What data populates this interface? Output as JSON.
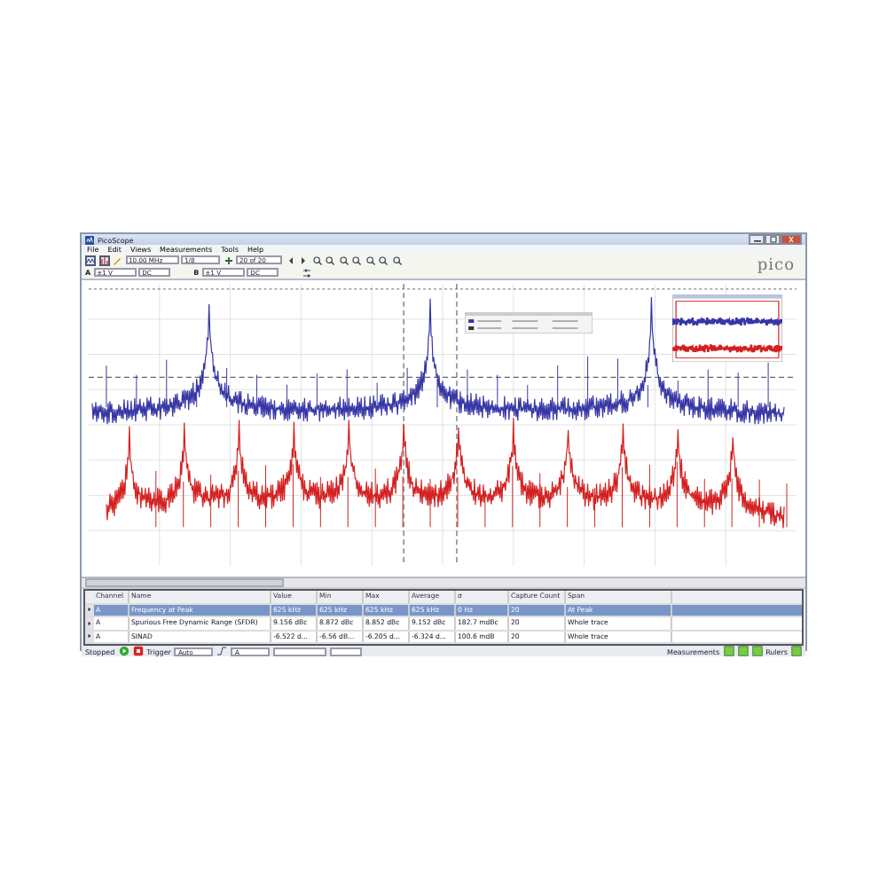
{
  "window": {
    "title": "PicoScope"
  },
  "menu": [
    "File",
    "Edit",
    "Views",
    "Measurements",
    "Tools",
    "Help"
  ],
  "toolbar": {
    "timebase": "10.00 MHz",
    "zoom": "1/8",
    "buffer": "20 of 20"
  },
  "channels": [
    {
      "name": "A",
      "range": "±1 V",
      "coupling": "DC"
    },
    {
      "name": "B",
      "range": "±1 V",
      "coupling": "DC"
    }
  ],
  "logo": "pico",
  "measurements": {
    "columns": [
      "Channel",
      "Name",
      "Value",
      "Min",
      "Max",
      "Average",
      "σ",
      "Capture Count",
      "Span"
    ],
    "rows": [
      {
        "selected": true,
        "cells": [
          "A",
          "Frequency at Peak",
          "625 kHz",
          "625 kHz",
          "625 kHz",
          "625 kHz",
          "0 Hz",
          "20",
          "At Peak"
        ]
      },
      {
        "selected": false,
        "cells": [
          "A",
          "Spurious Free Dynamic Range (SFDR)",
          "9.156 dBc",
          "8.872 dBc",
          "8.852 dBc",
          "9.152 dBc",
          "182.7 mdBc",
          "20",
          "Whole trace"
        ]
      },
      {
        "selected": false,
        "cells": [
          "A",
          "SINAD",
          "-6.522 d...",
          "-6.56 dB...",
          "-6.205 d...",
          "-6.324 d...",
          "100.6 mdB",
          "20",
          "Whole trace"
        ]
      }
    ]
  },
  "status_bar": {
    "state": "Stopped",
    "trigger_label": "Trigger",
    "trigger_mode": "Auto",
    "trigger_channel": "A",
    "measurements_label": "Measurements",
    "rulers_label": "Rulers"
  }
}
